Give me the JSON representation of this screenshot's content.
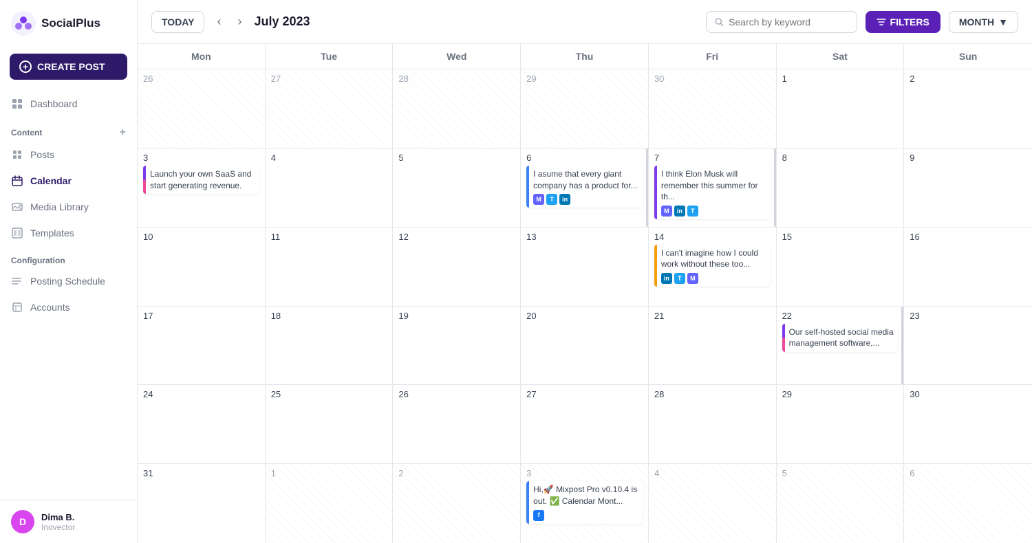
{
  "app": {
    "name": "SocialPlus"
  },
  "sidebar": {
    "create_btn": "CREATE POST",
    "sections": {
      "main": {
        "items": [
          {
            "id": "dashboard",
            "label": "Dashboard"
          }
        ]
      },
      "content": {
        "label": "Content",
        "items": [
          {
            "id": "posts",
            "label": "Posts"
          },
          {
            "id": "calendar",
            "label": "Calendar",
            "active": true
          },
          {
            "id": "media",
            "label": "Media Library"
          },
          {
            "id": "templates",
            "label": "Templates"
          }
        ]
      },
      "configuration": {
        "label": "Configuration",
        "items": [
          {
            "id": "posting_schedule",
            "label": "Posting Schedule"
          },
          {
            "id": "accounts",
            "label": "Accounts"
          }
        ]
      }
    },
    "user": {
      "name": "Dima B.",
      "role": "Inovector",
      "initial": "D"
    }
  },
  "topbar": {
    "today_label": "TODAY",
    "month_title": "July 2023",
    "search_placeholder": "Search by keyword",
    "filters_label": "FILTERS",
    "month_select_label": "MONTH"
  },
  "calendar": {
    "headers": [
      "Mon",
      "Tue",
      "Wed",
      "Thu",
      "Fri",
      "Sat",
      "Sun"
    ],
    "rows": [
      {
        "cells": [
          {
            "date": "26",
            "other": true,
            "posts": []
          },
          {
            "date": "27",
            "other": true,
            "posts": []
          },
          {
            "date": "28",
            "other": true,
            "posts": []
          },
          {
            "date": "29",
            "other": true,
            "posts": []
          },
          {
            "date": "30",
            "other": true,
            "posts": []
          },
          {
            "date": "1",
            "other": false,
            "posts": []
          },
          {
            "date": "2",
            "other": false,
            "posts": []
          }
        ]
      },
      {
        "cells": [
          {
            "date": "3",
            "other": false,
            "posts": [
              {
                "text": "Launch your own SaaS and start generating revenue.",
                "bar_color": "bar-purple",
                "bar2_color": "bar-pink",
                "icons": []
              }
            ]
          },
          {
            "date": "4",
            "other": false,
            "posts": []
          },
          {
            "date": "5",
            "other": false,
            "posts": []
          },
          {
            "date": "6",
            "other": false,
            "posts": [
              {
                "text": "I asume that every giant company has a product for...",
                "bar_color": "bar-blue",
                "icons": [
                  "mastodon",
                  "twitter",
                  "linkedin"
                ]
              }
            ]
          },
          {
            "date": "7",
            "other": false,
            "posts": [
              {
                "text": "I think Elon Musk will remember this summer for th...",
                "bar_color": "bar-purple",
                "icons": [
                  "mastodon",
                  "linkedin",
                  "twitter"
                ]
              }
            ]
          },
          {
            "date": "8",
            "other": false,
            "posts": []
          },
          {
            "date": "9",
            "other": false,
            "posts": []
          }
        ]
      },
      {
        "cells": [
          {
            "date": "10",
            "other": false,
            "posts": []
          },
          {
            "date": "11",
            "other": false,
            "posts": []
          },
          {
            "date": "12",
            "other": false,
            "posts": []
          },
          {
            "date": "13",
            "other": false,
            "posts": []
          },
          {
            "date": "14",
            "other": false,
            "posts": [
              {
                "text": "I can't imagine how I could work without these too...",
                "bar_color": "bar-yellow",
                "icons": [
                  "linkedin",
                  "twitter",
                  "mastodon"
                ]
              }
            ]
          },
          {
            "date": "15",
            "other": false,
            "posts": []
          },
          {
            "date": "16",
            "other": false,
            "posts": []
          }
        ]
      },
      {
        "cells": [
          {
            "date": "17",
            "other": false,
            "posts": []
          },
          {
            "date": "18",
            "other": false,
            "posts": []
          },
          {
            "date": "19",
            "other": false,
            "posts": []
          },
          {
            "date": "20",
            "other": false,
            "posts": []
          },
          {
            "date": "21",
            "other": false,
            "posts": []
          },
          {
            "date": "22",
            "other": false,
            "posts": [
              {
                "text": "Our self-hosted social media management software,...",
                "bar_color": "bar-blue",
                "bar2_color": "bar-pink",
                "icons": []
              }
            ]
          },
          {
            "date": "23",
            "other": false,
            "posts": []
          }
        ]
      },
      {
        "cells": [
          {
            "date": "24",
            "other": false,
            "posts": []
          },
          {
            "date": "25",
            "other": false,
            "posts": []
          },
          {
            "date": "26",
            "other": false,
            "posts": []
          },
          {
            "date": "27",
            "other": false,
            "posts": []
          },
          {
            "date": "28",
            "other": false,
            "posts": []
          },
          {
            "date": "29",
            "other": false,
            "posts": []
          },
          {
            "date": "30",
            "other": false,
            "posts": []
          }
        ]
      },
      {
        "cells": [
          {
            "date": "31",
            "other": false,
            "posts": []
          },
          {
            "date": "1",
            "other": true,
            "posts": []
          },
          {
            "date": "2",
            "other": true,
            "posts": []
          },
          {
            "date": "3",
            "other": true,
            "posts": [
              {
                "text": "Hi,🚀 Mixpost Pro v0.10.4 is out. ✅ Calendar Mont...",
                "bar_color": "bar-blue",
                "icons": [
                  "facebook"
                ]
              }
            ]
          },
          {
            "date": "4",
            "other": true,
            "posts": []
          },
          {
            "date": "5",
            "other": true,
            "posts": []
          },
          {
            "date": "6",
            "other": true,
            "posts": []
          }
        ]
      }
    ]
  }
}
